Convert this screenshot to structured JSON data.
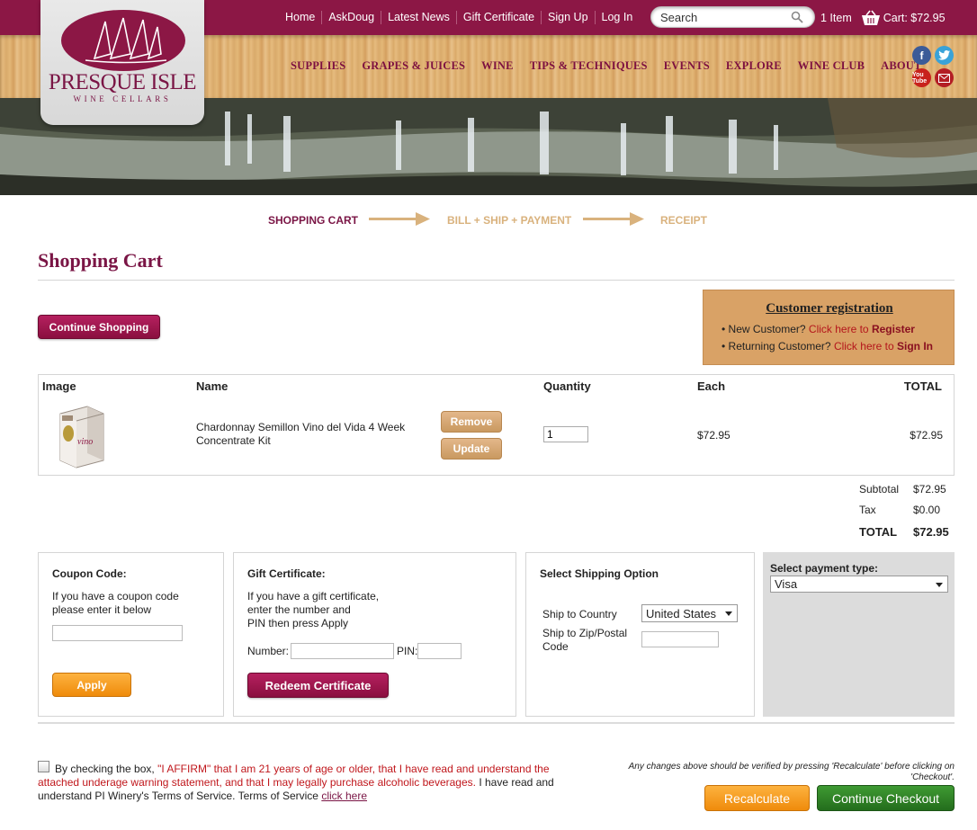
{
  "header": {
    "nav": [
      "Home",
      "AskDoug",
      "Latest News",
      "Gift Certificate",
      "Sign Up",
      "Log In"
    ],
    "search_placeholder": "Search",
    "cart_items": "1 Item",
    "cart_total": "Cart: $72.95",
    "main_nav": [
      "SUPPLIES",
      "GRAPES & JUICES",
      "WINE",
      "TIPS & TECHNIQUES",
      "EVENTS",
      "EXPLORE",
      "WINE CLUB",
      "ABOUT"
    ],
    "social": {
      "facebook": "f",
      "youtube": "You Tube"
    }
  },
  "logo": {
    "name": "PRESQUE ISLE",
    "sub": "WINE CELLARS"
  },
  "steps": [
    "SHOPPING CART",
    "BILL + SHIP + PAYMENT",
    "RECEIPT"
  ],
  "colors": {
    "brand": "#8c1745",
    "step_active": "#7a1545",
    "step_inactive": "#d9b27d"
  },
  "page_title": "Shopping Cart",
  "continue_shopping": "Continue Shopping",
  "registration": {
    "title": "Customer registration",
    "new_prefix": "• New Customer?",
    "new_link": "Click here to",
    "new_action": "Register",
    "ret_prefix": "• Returning Customer?",
    "ret_link": "Click here to",
    "ret_action": "Sign In"
  },
  "cart": {
    "headers": {
      "image": "Image",
      "name": "Name",
      "quantity": "Quantity",
      "each": "Each",
      "total": "TOTAL"
    },
    "item": {
      "name": "Chardonnay Semillon Vino del Vida 4 Week Concentrate Kit",
      "quantity": "1",
      "each": "$72.95",
      "total": "$72.95",
      "remove": "Remove",
      "update": "Update"
    }
  },
  "totals": {
    "subtotal_label": "Subtotal",
    "subtotal": "$72.95",
    "tax_label": "Tax",
    "tax": "$0.00",
    "total_label": "TOTAL",
    "total": "$72.95"
  },
  "coupon": {
    "heading": "Coupon Code:",
    "text1": "If you have a coupon code",
    "text2": "please enter it below",
    "apply": "Apply"
  },
  "gift": {
    "heading": "Gift Certificate:",
    "text1": "If you have a gift certificate,",
    "text2": "enter the number and",
    "text3": "PIN then press Apply",
    "number_label": "Number:",
    "pin_label": "PIN:",
    "redeem": "Redeem Certificate"
  },
  "shipping": {
    "heading": "Select Shipping Option",
    "country_label": "Ship to Country",
    "country": "United States",
    "zip_label1": "Ship to Zip/Postal",
    "zip_label2": "Code"
  },
  "payment": {
    "heading": "Select payment type:",
    "selected": "Visa"
  },
  "footer": {
    "terms_pre": "By checking the box,",
    "terms_red": "\"I AFFIRM\" that I am 21 years of age or older, that I have read and understand the attached underage warning statement, and that I may legally purchase alcoholic beverages.",
    "terms_post": "I have read and understand PI Winery's Terms of Service. Terms of Service",
    "terms_link": "click here",
    "note": "Any changes above should be verified by pressing 'Recalculate' before clicking on 'Checkout'.",
    "recalculate": "Recalculate",
    "checkout": "Continue Checkout"
  }
}
